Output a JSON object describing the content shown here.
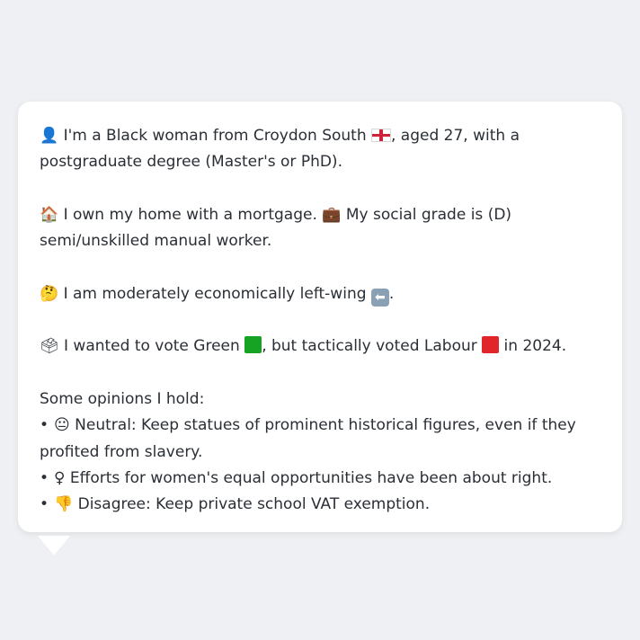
{
  "profile": {
    "line1": {
      "icon": "person-silhouette-icon",
      "text_a": "👤",
      "text_b": " I'm a Black woman from Croydon South ",
      "flag": "england-flag-icon",
      "text_c": ", aged 27, with a postgraduate degree (Master's or PhD)."
    },
    "line2": {
      "house": "🏠",
      "text_a": " I own my home with a mortgage. ",
      "briefcase": "💼",
      "text_b": " My social grade is (D) semi/unskilled manual worker."
    },
    "line3": {
      "thinking": "🤔",
      "text_a": " I am moderately economically left-wing ",
      "arrow": "⬅",
      "text_b": "."
    },
    "line4": {
      "ballot": "🗳",
      "text_a": " I wanted to vote Green ",
      "green_color": "#16a323",
      "text_b": ", but tactically voted Labour ",
      "red_color": "#e0252b",
      "text_c": " in 2024."
    },
    "opinions": {
      "heading": "Some opinions I hold:",
      "items": [
        {
          "bullet": "•",
          "emoji": "😐",
          "text": " Neutral: Keep statues of prominent historical figures, even if they profited from slavery."
        },
        {
          "bullet": "•",
          "emoji": "♀",
          "text": "  Efforts for women's equal opportunities have been about right."
        },
        {
          "bullet": "•",
          "emoji": "👎",
          "text": " Disagree: Keep private school VAT exemption."
        }
      ]
    }
  },
  "colors": {
    "background": "#eef0f3",
    "bubble": "#ffffff",
    "text": "#2a2f36"
  }
}
